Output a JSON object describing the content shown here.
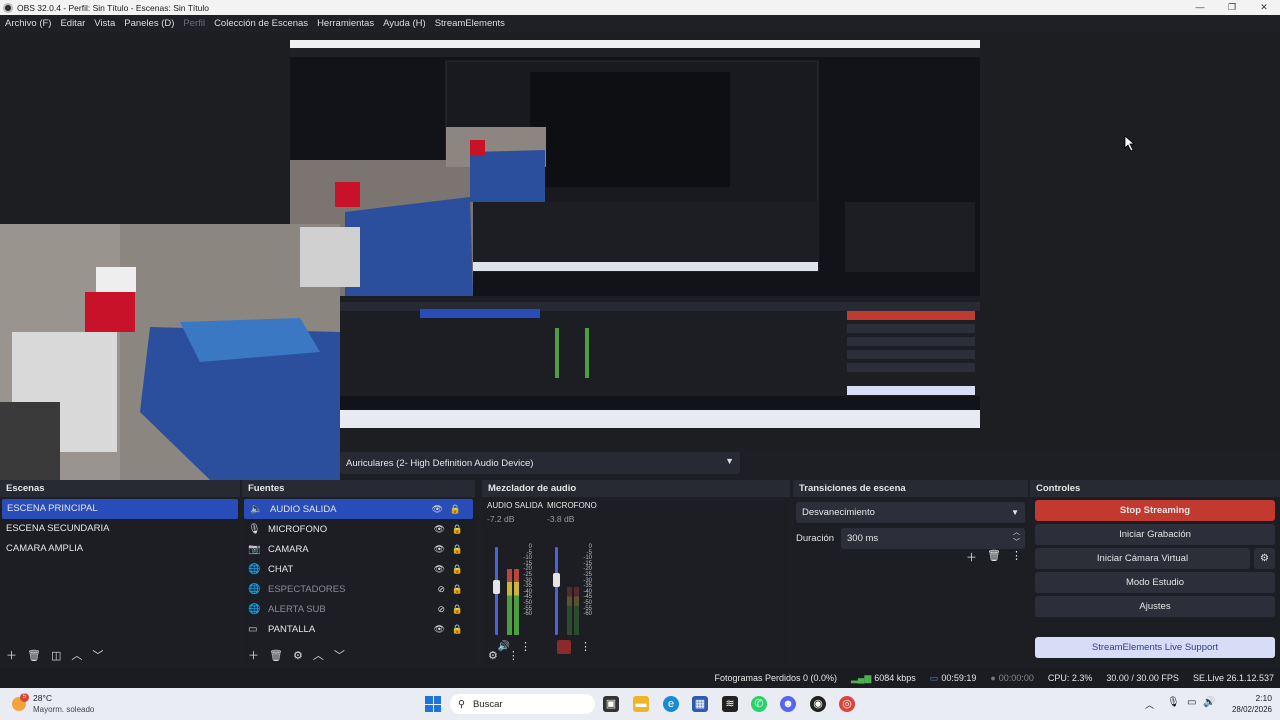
{
  "window": {
    "title": "OBS 32.0.4 - Perfil: Sin Título - Escenas: Sin Título"
  },
  "menu": [
    {
      "label": "Archivo (F)",
      "enabled": true
    },
    {
      "label": "Editar",
      "enabled": true
    },
    {
      "label": "Vista",
      "enabled": true
    },
    {
      "label": "Paneles (D)",
      "enabled": true
    },
    {
      "label": "Perfil",
      "enabled": false
    },
    {
      "label": "Colección de Escenas",
      "enabled": true
    },
    {
      "label": "Herramientas",
      "enabled": true
    },
    {
      "label": "Ayuda (H)",
      "enabled": true
    },
    {
      "label": "StreamElements",
      "enabled": true
    }
  ],
  "audio_device": {
    "selected": "Auriculares (2- High Definition Audio Device)"
  },
  "scenes": {
    "title": "Escenas",
    "items": [
      "ESCENA PRINCIPAL",
      "ESCENA SECUNDARIA",
      "CAMARA AMPLIA"
    ],
    "selected_index": 0
  },
  "sources": {
    "title": "Fuentes",
    "items": [
      {
        "label": "AUDIO SALIDA",
        "icon": "speaker-icon",
        "visible": true,
        "selected": true
      },
      {
        "label": "MICROFONO",
        "icon": "microphone-icon",
        "visible": true,
        "selected": false
      },
      {
        "label": "CAMARA",
        "icon": "camera-icon",
        "visible": true,
        "selected": false
      },
      {
        "label": "CHAT",
        "icon": "browser-icon",
        "visible": true,
        "selected": false
      },
      {
        "label": "ESPECTADORES",
        "icon": "browser-icon",
        "visible": false,
        "selected": false
      },
      {
        "label": "ALERTA SUB",
        "icon": "browser-icon",
        "visible": false,
        "selected": false
      },
      {
        "label": "PANTALLA",
        "icon": "monitor-icon",
        "visible": true,
        "selected": false
      }
    ]
  },
  "mixer": {
    "title": "Mezclador de audio",
    "channels": [
      {
        "name": "AUDIO SALIDA",
        "db": "-7.2 dB",
        "level": 0.75,
        "fader": 0.62,
        "muted": false
      },
      {
        "name": "MICROFONO",
        "db": "-3.8 dB",
        "level": 0.55,
        "fader": 0.7,
        "muted": true
      }
    ],
    "ticks": [
      "0",
      "-5",
      "-10",
      "-15",
      "-20",
      "-25",
      "-30",
      "-35",
      "-40",
      "-45",
      "-50",
      "-55",
      "-60"
    ]
  },
  "transitions": {
    "title": "Transiciones de escena",
    "selected": "Desvanecimiento",
    "duration_label": "Duración",
    "duration_value": "300 ms"
  },
  "controls": {
    "title": "Controles",
    "stop_streaming": "Stop Streaming",
    "start_recording": "Iniciar Grabación",
    "virtual_camera": "Iniciar Cámara Virtual",
    "studio_mode": "Modo Estudio",
    "settings": "Ajustes",
    "support": "StreamElements Live Support"
  },
  "status": {
    "dropped_frames": "Fotogramas Perdidos 0 (0.0%)",
    "bitrate": "6084 kbps",
    "stream_time": "00:59:19",
    "rec_time": "00:00:00",
    "cpu": "CPU: 2.3%",
    "fps": "30.00 / 30.00 FPS",
    "version": "SE.Live 26.1.12.537"
  },
  "taskbar": {
    "weather_temp": "28°C",
    "weather_desc": "Mayorm. soleado",
    "weather_badge": "5",
    "search": "Buscar",
    "time": "2:10",
    "date": "28/02/2026"
  },
  "colors": {
    "accent": "#284cb8",
    "stop": "#c2392f",
    "support": "#d7dcf7"
  }
}
